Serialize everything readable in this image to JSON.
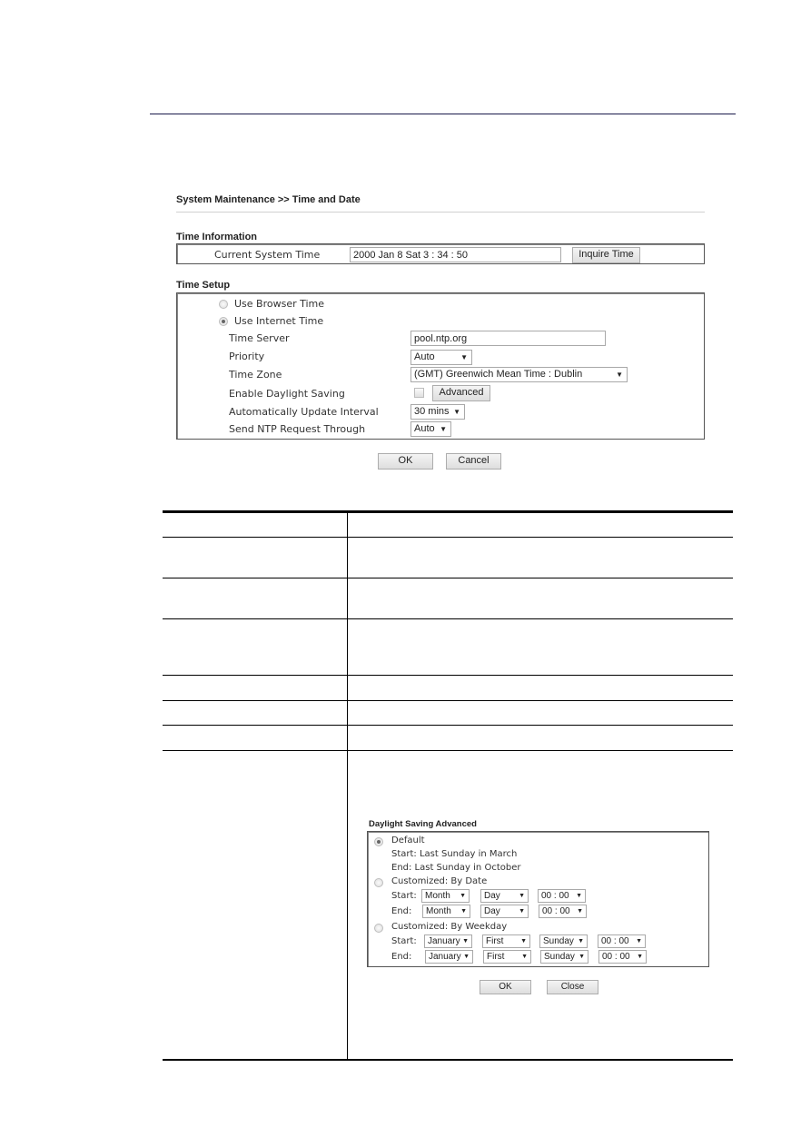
{
  "breadcrumb": "System Maintenance >> Time and Date",
  "time_information": {
    "title": "Time Information",
    "current_time_label": "Current System Time",
    "current_time_value": "2000 Jan 8 Sat 3 : 34 : 50",
    "inquire_button": "Inquire Time"
  },
  "time_setup": {
    "title": "Time Setup",
    "radio_browser": "Use Browser Time",
    "radio_internet": "Use Internet Time",
    "selected": "Use Internet Time",
    "time_server_label": "Time Server",
    "time_server_value": "pool.ntp.org",
    "priority_label": "Priority",
    "priority_value": "Auto",
    "time_zone_label": "Time Zone",
    "time_zone_value": "(GMT) Greenwich Mean Time : Dublin",
    "daylight_label": "Enable Daylight Saving",
    "daylight_checked": false,
    "advanced_button": "Advanced",
    "interval_label": "Automatically Update Interval",
    "interval_value": "30 mins",
    "ntp_through_label": "Send NTP Request Through",
    "ntp_through_value": "Auto"
  },
  "actions": {
    "ok": "OK",
    "cancel": "Cancel"
  },
  "icons": {
    "dropdown_arrow": "▼"
  },
  "dialog": {
    "title": "Daylight Saving Advanced",
    "default_label": "Default",
    "default_start": "Start: Last Sunday in March",
    "default_end": "End: Last Sunday in October",
    "by_date_label": "Customized: By Date",
    "by_weekday_label": "Customized: By Weekday",
    "start_label": "Start:",
    "end_label": "End:",
    "by_date_start": {
      "month": "Month",
      "day": "Day",
      "time": "00 : 00"
    },
    "by_date_end": {
      "month": "Month",
      "day": "Day",
      "time": "00 : 00"
    },
    "by_weekday_start": {
      "month": "January",
      "week": "First",
      "weekday": "Sunday",
      "time": "00 : 00"
    },
    "by_weekday_end": {
      "month": "January",
      "week": "First",
      "weekday": "Sunday",
      "time": "00 : 00"
    },
    "ok": "OK",
    "close": "Close"
  }
}
